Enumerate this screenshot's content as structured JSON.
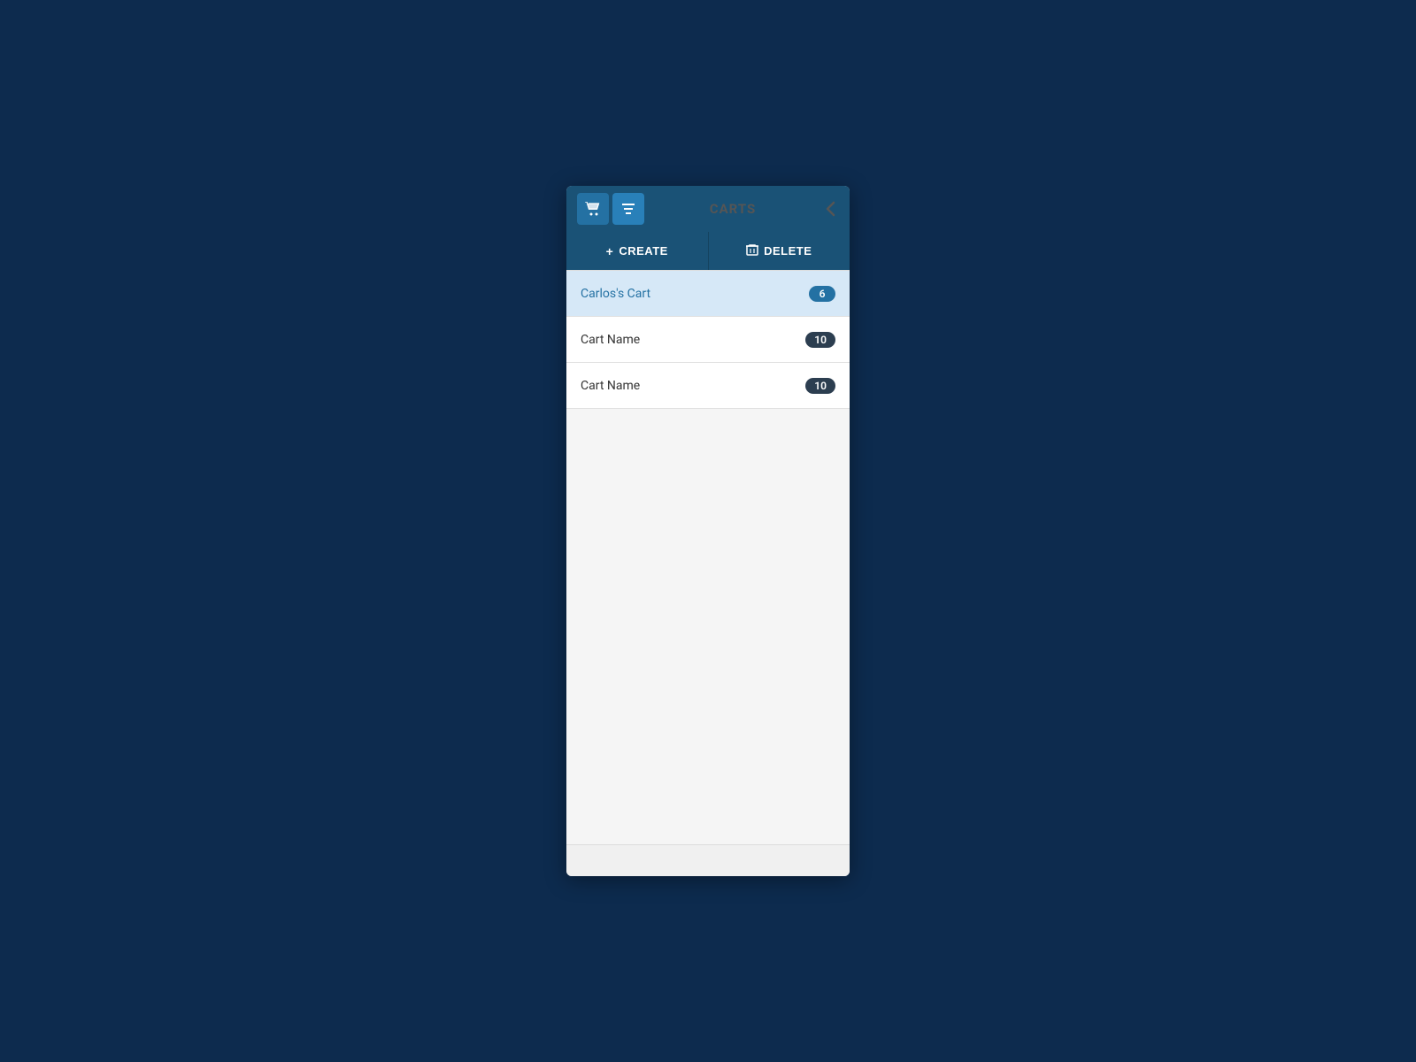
{
  "header": {
    "title": "CARTS",
    "back_label": "‹"
  },
  "toolbar": {
    "create_label": "CREATE",
    "delete_label": "DELETE",
    "create_icon": "+",
    "delete_icon": "🗑"
  },
  "carts": [
    {
      "id": 1,
      "name": "Carlos's Cart",
      "count": "6",
      "selected": true,
      "badge_type": "blue"
    },
    {
      "id": 2,
      "name": "Cart Name",
      "count": "10",
      "selected": false,
      "badge_type": "dark"
    },
    {
      "id": 3,
      "name": "Cart Name",
      "count": "10",
      "selected": false,
      "badge_type": "dark"
    }
  ]
}
